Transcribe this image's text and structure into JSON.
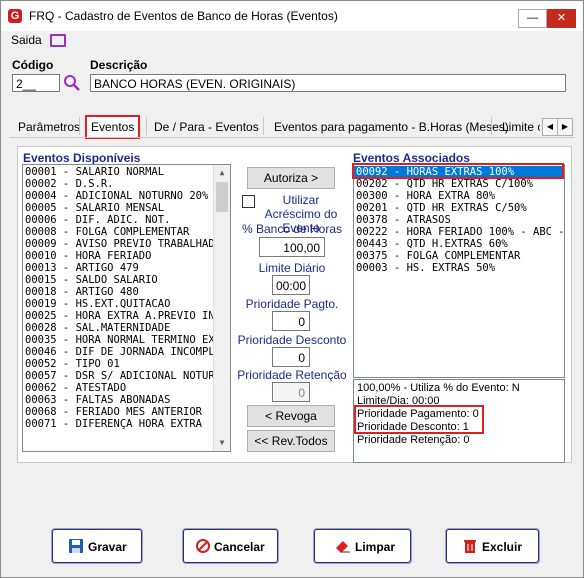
{
  "window": {
    "title": "FRQ - Cadastro de Eventos de Banco de Horas (Eventos)",
    "app_icon_letter": "G"
  },
  "menu": {
    "saida": "Saida"
  },
  "form": {
    "codigo_label": "Código",
    "codigo_value": "2__",
    "descricao_label": "Descrição",
    "descricao_value": "BANCO HORAS (EVEN. ORIGINAIS)"
  },
  "tabs": [
    {
      "label": "Parâmetros"
    },
    {
      "label": "Eventos"
    },
    {
      "label": "De / Para - Eventos"
    },
    {
      "label": "Eventos para pagamento - B.Horas (Meses)"
    },
    {
      "label": "Limite c"
    }
  ],
  "disponiveis": {
    "title": "Eventos Disponíveis",
    "items": [
      "00001 - SALARIO NORMAL",
      "00002 - D.S.R.",
      "00004 - ADICIONAL NOTURNO 20%",
      "00005 - SALARIO MENSAL",
      "00006 - DIF. ADIC. NOT.",
      "00008 - FOLGA COMPLEMENTAR",
      "00009 - AVISO PREVIO TRABALHADO",
      "00010 - HORA FERIADO",
      "00013 - ARTIGO 479",
      "00015 - SALDO SALARIO",
      "00018 - ARTIGO 480",
      "00019 - HS.EXT.QUITACAO",
      "00025 - HORA EXTRA A.PREVIO INDE",
      "00028 - SAL.MATERNIDADE",
      "00035 - HORA NORMAL TERMINO EX",
      "00046 - DIF DE JORNADA INCOMPLE",
      "00052 - TIPO 01",
      "00057 - DSR S/ ADICIONAL NOTURN",
      "00062 - ATESTADO",
      "00063 - FALTAS ABONADAS",
      "00068 - FERIADO MES ANTERIOR",
      "00071 - DIFERENÇA HORA EXTRA"
    ]
  },
  "controls": {
    "autoriza": "Autoriza >",
    "utilizar_acrescimo": "Utilizar Acréscimo do Evento",
    "pct_label": "% Banco de Horas",
    "pct_value": "100,00",
    "limite_label": "Limite Diário",
    "limite_value": "00:00",
    "prio_pagto_label": "Prioridade Pagto.",
    "prio_pagto_value": "0",
    "prio_desconto_label": "Prioridade Desconto",
    "prio_desconto_value": "0",
    "prio_retencao_label": "Prioridade Retenção",
    "prio_retencao_value": "0",
    "revoga": "< Revoga",
    "rev_todos": "<< Rev.Todos"
  },
  "associados": {
    "title": "Eventos Associados",
    "items": [
      "00092 - HORAS EXTRAS 100%",
      "00202 - QTD HR EXTRAS C/100%",
      "00300 - HORA EXTRA 80%",
      "00201 - QTD HR EXTRAS C/50%",
      "00378 - ATRASOS",
      "00222 - HORA FERIADO 100% - ABC - HO",
      "00443 - QTD H.EXTRAS 60%",
      "00375 - FOLGA COMPLEMENTAR",
      "00003 - HS. EXTRAS 50%"
    ],
    "selected_index": 0
  },
  "info": {
    "line1": "100,00% - Utiliza % do Evento: N",
    "line2": "Limite/Dia: 00:00",
    "line3": "Prioridade Pagamento: 0",
    "line4": "Prioridade Desconto: 1",
    "line5": "Prioridade Retenção: 0"
  },
  "actions": {
    "gravar": "Gravar",
    "cancelar": "Cancelar",
    "limpar": "Limpar",
    "excluir": "Excluir"
  },
  "colors": {
    "highlight": "#e02020",
    "selection": "#0078d7",
    "group_title": "#1e2a8a"
  }
}
